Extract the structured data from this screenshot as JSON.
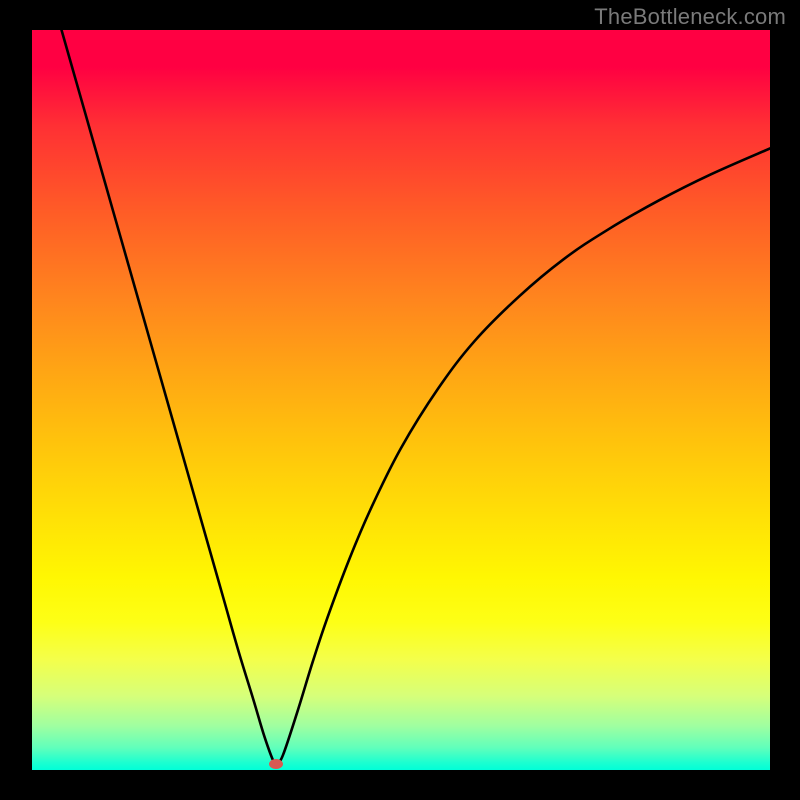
{
  "watermark": "TheBottleneck.com",
  "chart_data": {
    "type": "line",
    "title": "",
    "xlabel": "",
    "ylabel": "",
    "xlim": [
      0,
      100
    ],
    "ylim": [
      0,
      100
    ],
    "grid": false,
    "series": [
      {
        "name": "bottleneck-curve",
        "x": [
          4.0,
          6.0,
          8.0,
          10.0,
          12.0,
          14.0,
          16.0,
          18.0,
          20.0,
          22.0,
          24.0,
          26.0,
          28.0,
          30.0,
          31.5,
          32.8,
          33.2,
          34.0,
          36.0,
          38.0,
          40.0,
          43.0,
          46.0,
          50.0,
          55.0,
          60.0,
          66.0,
          72.0,
          78.0,
          85.0,
          92.0,
          100.0
        ],
        "y": [
          100.0,
          93.0,
          86.0,
          79.0,
          72.0,
          65.0,
          58.0,
          51.0,
          44.0,
          37.0,
          30.0,
          23.0,
          16.0,
          9.5,
          4.5,
          1.0,
          1.0,
          2.0,
          8.0,
          14.5,
          20.5,
          28.5,
          35.5,
          43.5,
          51.5,
          58.0,
          64.0,
          69.0,
          73.0,
          77.0,
          80.5,
          84.0
        ]
      }
    ],
    "annotations": [
      {
        "name": "min-marker",
        "x": 33.0,
        "y": 0.8,
        "color": "#d85a53"
      }
    ]
  }
}
